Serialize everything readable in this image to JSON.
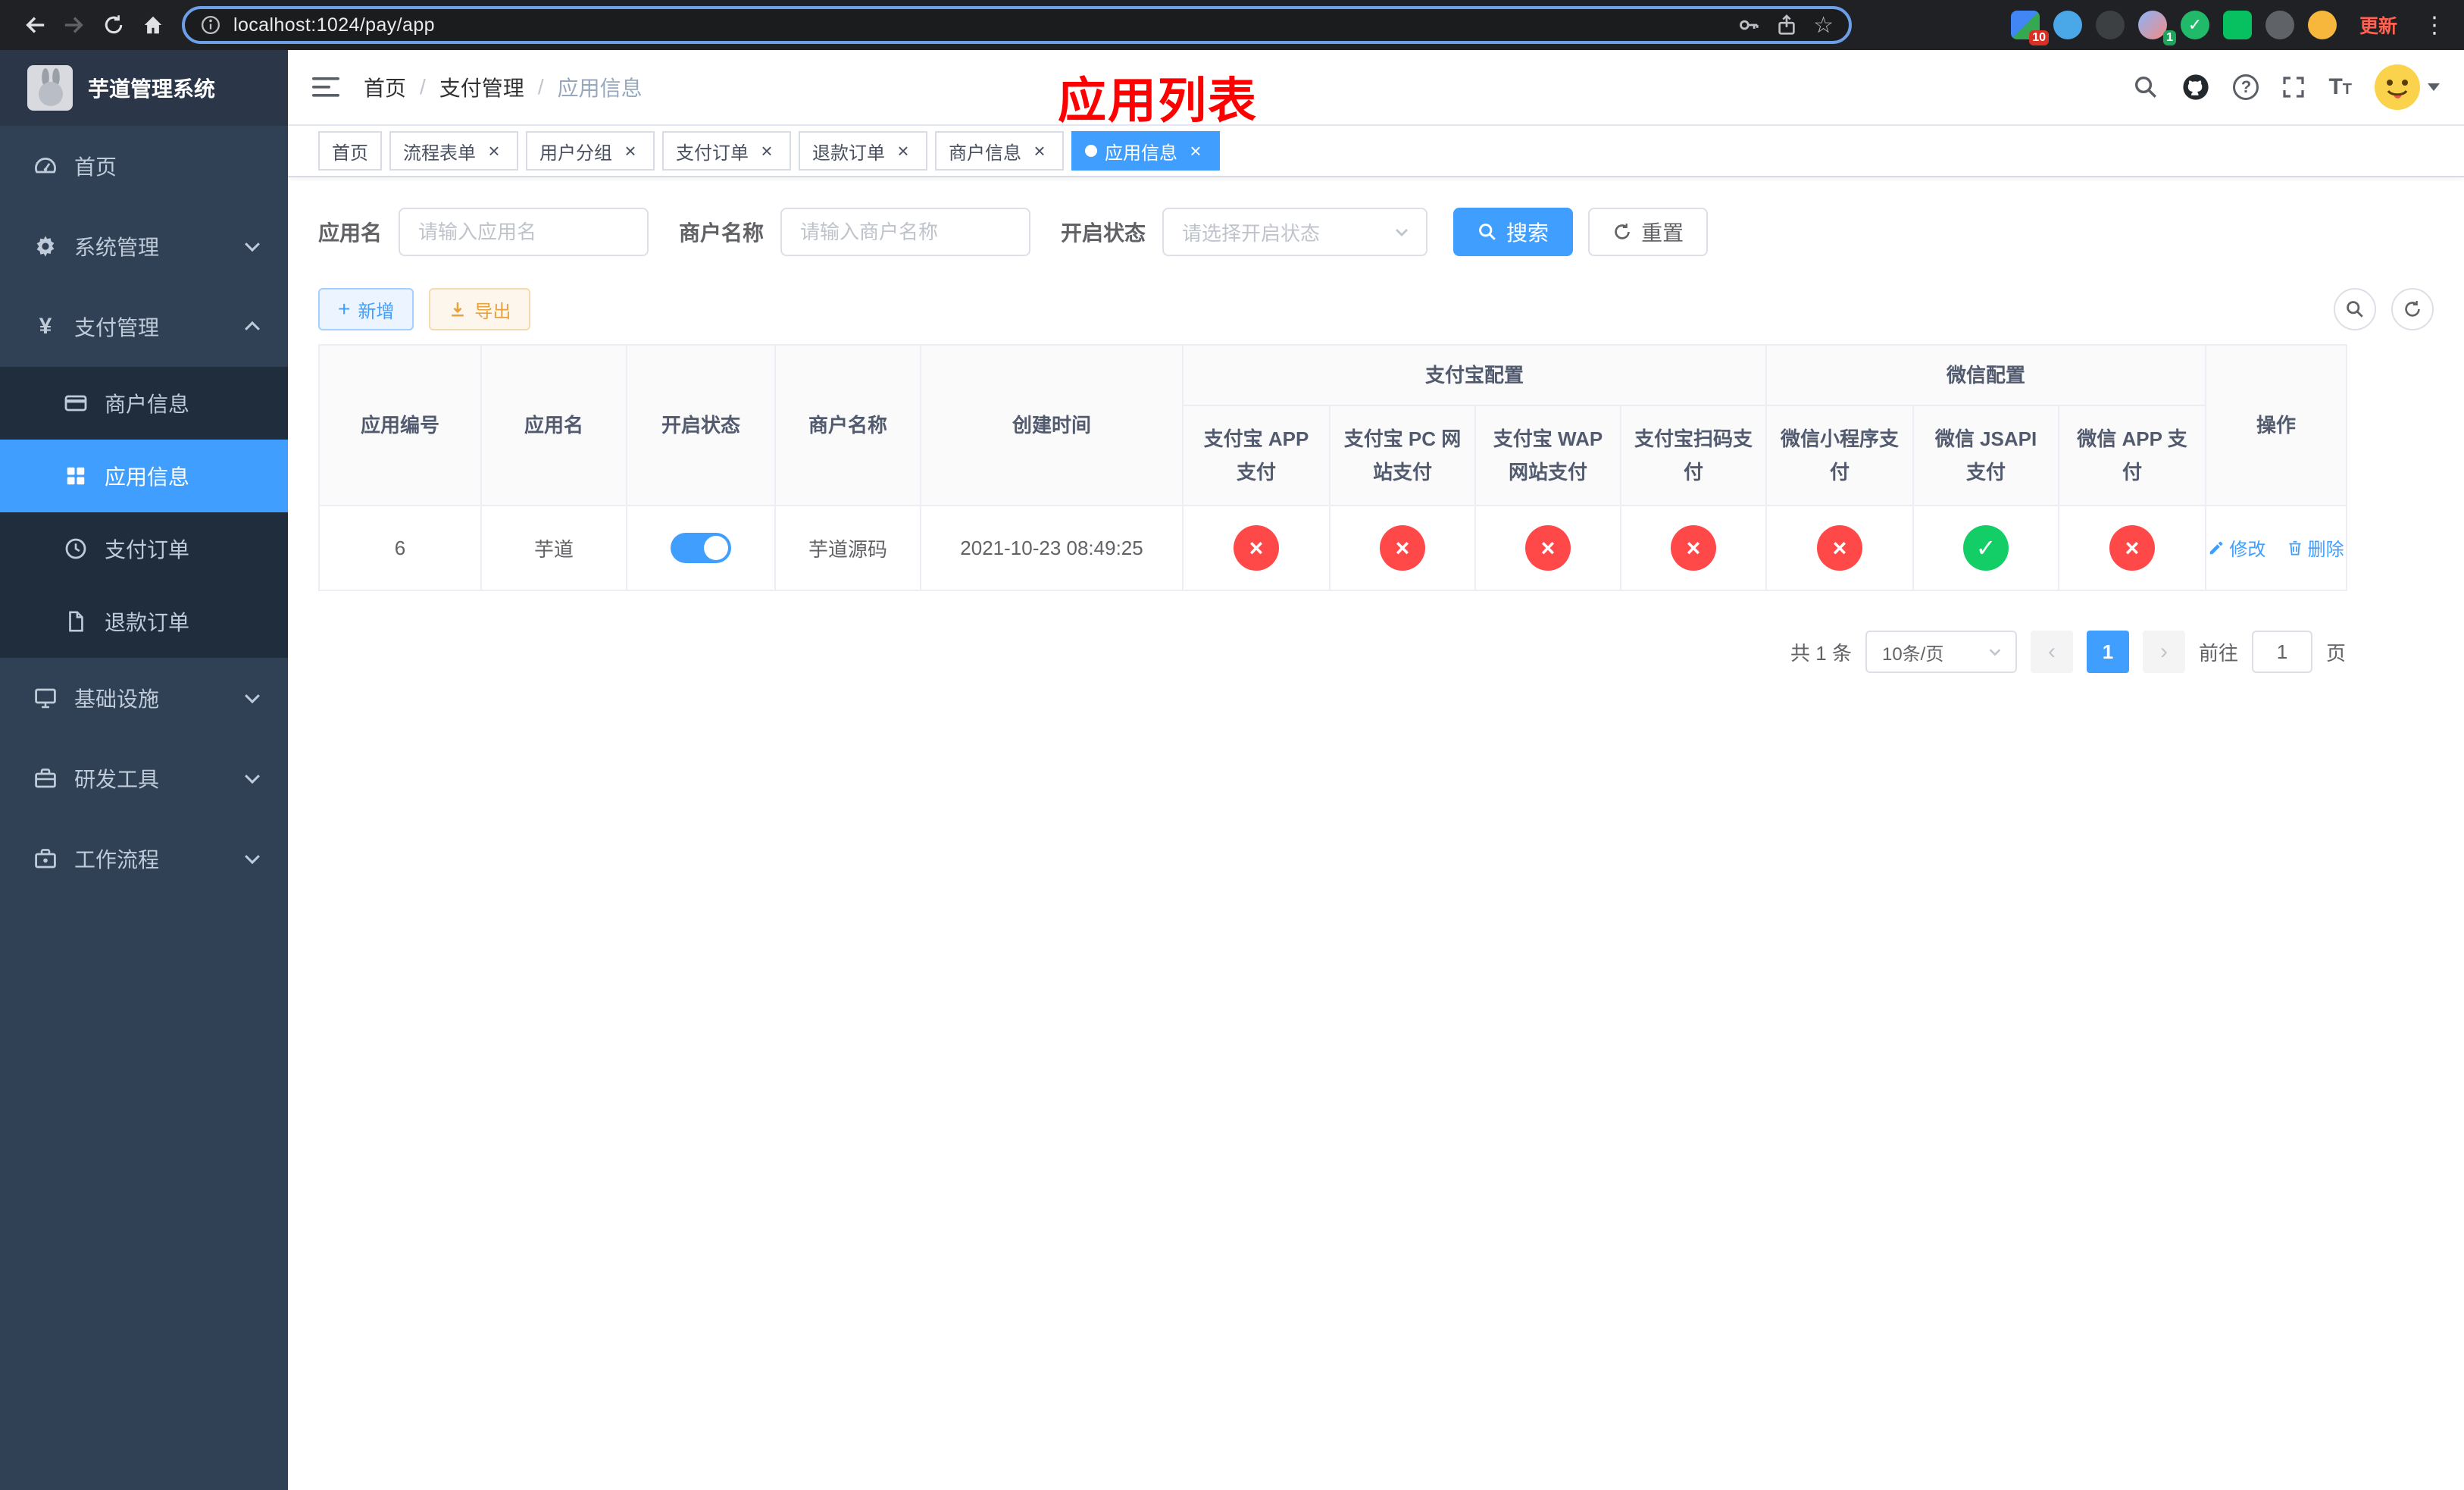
{
  "colors": {
    "primary": "#409eff",
    "success": "#13ce66",
    "danger": "#ff4949",
    "warning": "#e6a23c",
    "sidebar_bg": "#304156",
    "submenu_bg": "#1f2d3d",
    "annotation_red": "#ff0000"
  },
  "browser": {
    "url": "localhost:1024/pay/app",
    "update_label": "更新",
    "ext_badge_mosaic": "10",
    "ext_badge_avatar": "1"
  },
  "sidebar": {
    "title": "芋道管理系统",
    "items": {
      "home": "首页",
      "system": "系统管理",
      "pay": "支付管理",
      "merchant": "商户信息",
      "app": "应用信息",
      "order": "支付订单",
      "refund": "退款订单",
      "infra": "基础设施",
      "dev": "研发工具",
      "workflow": "工作流程"
    }
  },
  "navbar": {
    "breadcrumb": [
      "首页",
      "支付管理",
      "应用信息"
    ],
    "annotation": "应用列表"
  },
  "tabs": [
    {
      "label": "首页"
    },
    {
      "label": "流程表单"
    },
    {
      "label": "用户分组"
    },
    {
      "label": "支付订单"
    },
    {
      "label": "退款订单"
    },
    {
      "label": "商户信息"
    },
    {
      "label": "应用信息"
    }
  ],
  "filters": {
    "app_name_label": "应用名",
    "app_name_placeholder": "请输入应用名",
    "merchant_label": "商户名称",
    "merchant_placeholder": "请输入商户名称",
    "status_label": "开启状态",
    "status_placeholder": "请选择开启状态",
    "search_label": "搜索",
    "reset_label": "重置"
  },
  "toolbar": {
    "add_label": "新增",
    "export_label": "导出"
  },
  "table": {
    "headers": {
      "app_id": "应用编号",
      "app_name": "应用名",
      "status": "开启状态",
      "merchant": "商户名称",
      "created": "创建时间",
      "alipay_group": "支付宝配置",
      "wechat_group": "微信配置",
      "actions": "操作",
      "alipay_app": "支付宝 APP 支付",
      "alipay_pc": "支付宝 PC 网站支付",
      "alipay_wap": "支付宝 WAP 网站支付",
      "alipay_qr": "支付宝扫码支付",
      "wechat_lite": "微信小程序支付",
      "wechat_jsapi": "微信 JSAPI 支付",
      "wechat_app": "微信 APP 支付"
    },
    "row": {
      "id": "6",
      "name": "芋道",
      "enabled": true,
      "merchant": "芋道源码",
      "created": "2021-10-23 08:49:25",
      "alipay_app": false,
      "alipay_pc": false,
      "alipay_wap": false,
      "alipay_qr": false,
      "wechat_lite": false,
      "wechat_jsapi": true,
      "wechat_app": false,
      "edit_label": "修改",
      "delete_label": "删除"
    }
  },
  "pagination": {
    "total": "共 1 条",
    "page_size": "10条/页",
    "page": "1",
    "goto_prefix": "前往",
    "goto_value": "1",
    "goto_suffix": "页"
  }
}
